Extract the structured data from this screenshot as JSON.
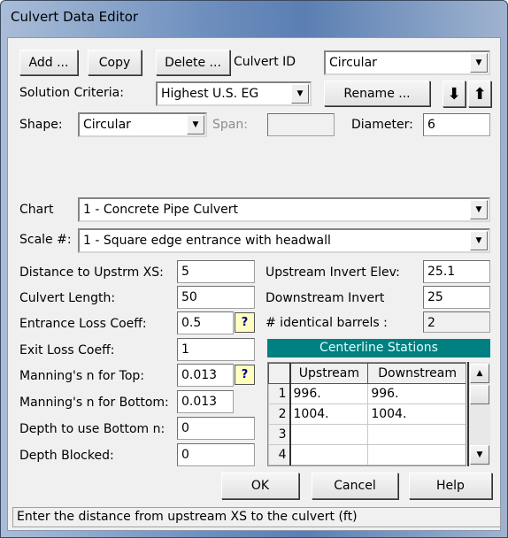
{
  "window": {
    "title": "Culvert Data Editor"
  },
  "toolbar": {
    "add": "Add ...",
    "copy": "Copy",
    "delete": "Delete ...",
    "culvert_id_label": "Culvert ID",
    "culvert_id_value": "Circular",
    "rename": "Rename ...",
    "move_down_icon": "arrow-down",
    "move_up_icon": "arrow-up"
  },
  "solution": {
    "label": "Solution Criteria:",
    "value": "Highest U.S. EG"
  },
  "shape": {
    "label": "Shape:",
    "value": "Circular",
    "span_label": "Span:",
    "span_value": "",
    "diameter_label": "Diameter:",
    "diameter_value": "6"
  },
  "chart": {
    "label": "Chart",
    "value": "1 - Concrete Pipe Culvert"
  },
  "scale": {
    "label": "Scale #:",
    "value": "1 - Square edge entrance with headwall"
  },
  "fields": [
    {
      "label": "Distance to Upstrm XS:",
      "value": "5"
    },
    {
      "label": "Culvert Length:",
      "value": "50"
    },
    {
      "label": "Entrance Loss Coeff:",
      "value": "0.5"
    },
    {
      "label": "Exit Loss Coeff:",
      "value": "1"
    },
    {
      "label": "Manning's n for Top:",
      "value": "0.013"
    },
    {
      "label": "Manning's n for Bottom:",
      "value": "0.013"
    },
    {
      "label": "Depth to use Bottom n:",
      "value": "0"
    },
    {
      "label": "Depth Blocked:",
      "value": "0"
    }
  ],
  "right": {
    "upstream_invert_label": "Upstream Invert Elev:",
    "upstream_invert_value": "25.1",
    "downstream_invert_label": "Downstream Invert",
    "downstream_invert_value": "25",
    "barrels_label": "# identical barrels :",
    "barrels_value": "2"
  },
  "stations": {
    "title": "Centerline Stations",
    "header_color": "#008080",
    "columns": [
      "Upstream",
      "Downstream"
    ],
    "rows": [
      [
        "1",
        "996.",
        "996."
      ],
      [
        "2",
        "1004.",
        "1004."
      ],
      [
        "3",
        "",
        ""
      ],
      [
        "4",
        "",
        ""
      ]
    ]
  },
  "buttons": {
    "ok": "OK",
    "cancel": "Cancel",
    "help": "Help"
  },
  "help_icon": "?",
  "status": "Enter the distance from upstream XS to the culvert (ft)"
}
